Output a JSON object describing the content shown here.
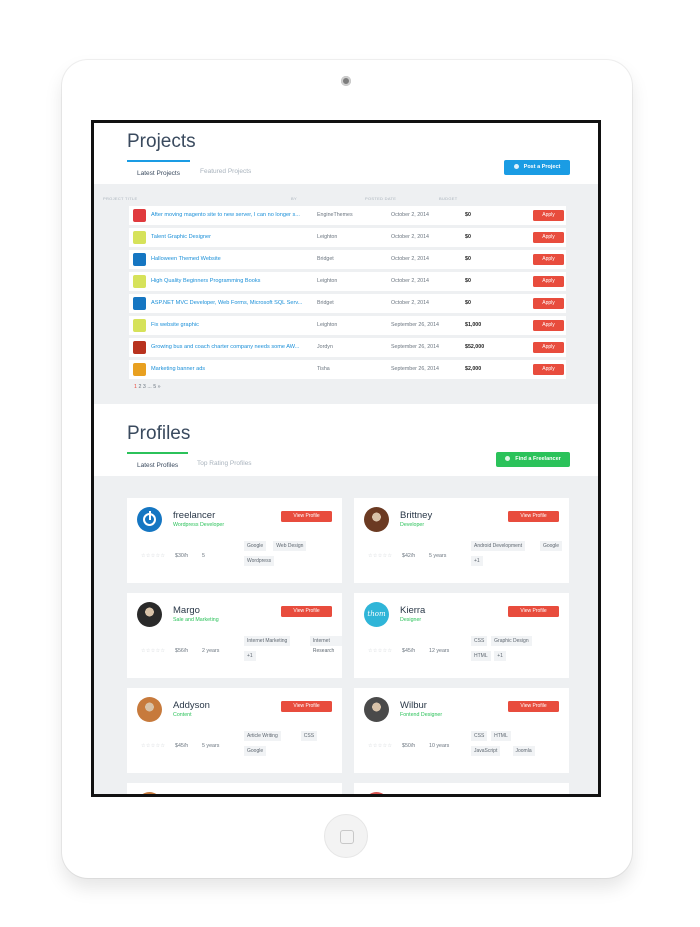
{
  "projects": {
    "title": "Projects",
    "tabs": [
      "Latest Projects",
      "Featured Projects"
    ],
    "post_button": "Post a Project",
    "columns": [
      "PROJECT TITLE",
      "BY",
      "POSTED DATE",
      "BUDGET"
    ],
    "rows": [
      {
        "title": "After moving magento site to new server, I can no longer s...",
        "by": "EngineThemes",
        "date": "October 2, 2014",
        "budget": "$0",
        "action": "Apply",
        "logo": "red-bird-logo",
        "color": "#e03a3e"
      },
      {
        "title": "Talent Graphic Designer",
        "by": "Leighton",
        "date": "October 2, 2014",
        "budget": "$0",
        "action": "Apply",
        "logo": "talent-logo",
        "color": "#d6e25a"
      },
      {
        "title": "Halloween Themed Website",
        "by": "Bridget",
        "date": "October 2, 2014",
        "budget": "$0",
        "action": "Apply",
        "logo": "power-logo",
        "color": "#1576c2"
      },
      {
        "title": "High Quality Beginners Programming Books",
        "by": "Leighton",
        "date": "October 2, 2014",
        "budget": "$0",
        "action": "Apply",
        "logo": "talent-logo",
        "color": "#d6e25a"
      },
      {
        "title": "ASP.NET MVC Developer, Web Forms, Microsoft SQL Serv...",
        "by": "Bridget",
        "date": "October 2, 2014",
        "budget": "$0",
        "action": "Apply",
        "logo": "power-logo",
        "color": "#1576c2"
      },
      {
        "title": "Fix website graphic",
        "by": "Leighton",
        "date": "September 26, 2014",
        "budget": "$1,000",
        "action": "Apply",
        "logo": "talent-logo",
        "color": "#d6e25a"
      },
      {
        "title": "Growing bus and coach charter company needs some AW...",
        "by": "Jordyn",
        "date": "September 26, 2014",
        "budget": "$52,000",
        "action": "Apply",
        "logo": "coach-logo",
        "color": "#b8321e"
      },
      {
        "title": "Marketing banner ads",
        "by": "Tisha",
        "date": "September 26, 2014",
        "budget": "$2,000",
        "action": "Apply",
        "logo": "marketing-logo",
        "color": "#e8a020"
      }
    ],
    "pager": {
      "current": "1",
      "pages": [
        "2",
        "3",
        "...",
        "5",
        "»"
      ]
    }
  },
  "profiles": {
    "title": "Profiles",
    "tabs": [
      "Latest Profiles",
      "Top Rating Profiles"
    ],
    "find_button": "Find a Freelancer",
    "stars": "☆☆☆☆☆",
    "cards": [
      {
        "name": "freelancer",
        "role": "Wordpress Developer",
        "button": "View Profile",
        "rate": "$30/h",
        "experience": "5",
        "skills": [
          "Google",
          "Web Design",
          "Wordpress"
        ],
        "avatar": "power-avatar",
        "avatar_color": "#1576c2"
      },
      {
        "name": "Brittney",
        "role": "Developer",
        "button": "View Profile",
        "rate": "$42/h",
        "experience": "5 years",
        "skills": [
          "Android Development",
          "Google",
          "+1"
        ],
        "avatar": "photo-avatar",
        "avatar_color": "#6b3a22"
      },
      {
        "name": "Margo",
        "role": "Sale and Marketing",
        "button": "View Profile",
        "rate": "$56/h",
        "experience": "2 years",
        "skills": [
          "Internet Marketing",
          "Internet Research",
          "+1"
        ],
        "avatar": "photo-avatar",
        "avatar_color": "#2a2a2a"
      },
      {
        "name": "Kierra",
        "role": "Designer",
        "button": "View Profile",
        "rate": "$45/h",
        "experience": "12 years",
        "skills": [
          "CSS",
          "Graphic Design",
          "HTML",
          "+1"
        ],
        "avatar": "thom-avatar",
        "avatar_color": "#2fb5d8",
        "avatar_text": "thom"
      },
      {
        "name": "Addyson",
        "role": "Content",
        "button": "View Profile",
        "rate": "$45/h",
        "experience": "5 years",
        "skills": [
          "Article Writing",
          "CSS",
          "Google"
        ],
        "avatar": "photo-avatar",
        "avatar_color": "#c77a3c"
      },
      {
        "name": "Wilbur",
        "role": "Fontend Designer",
        "button": "View Profile",
        "rate": "$50/h",
        "experience": "10 years",
        "skills": [
          "CSS",
          "HTML",
          "JavaScript",
          "Joomla"
        ],
        "avatar": "photo-avatar",
        "avatar_color": "#4a4a4a"
      }
    ]
  },
  "colors": {
    "accent_blue": "#1a9ce4",
    "accent_green": "#2bc25a",
    "apply_red": "#e84c3d"
  }
}
